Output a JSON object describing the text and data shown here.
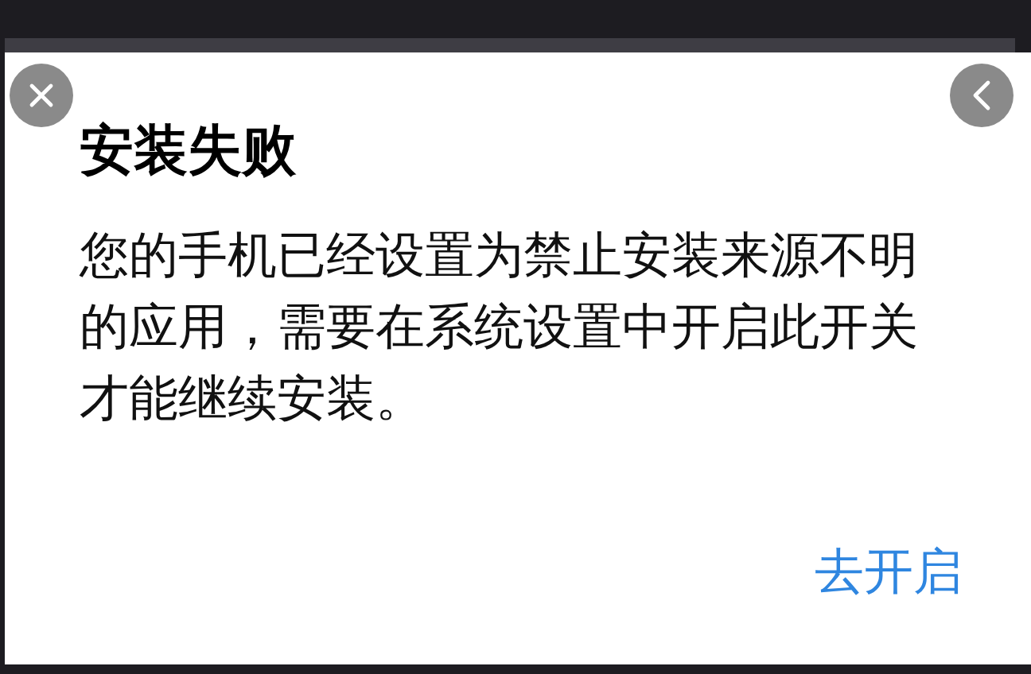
{
  "dialog": {
    "title": "安装失败",
    "message": "您的手机已经设置为禁止安装来源不明的应用，需要在系统设置中开启此开关才能继续安装。",
    "action": "去开启"
  }
}
